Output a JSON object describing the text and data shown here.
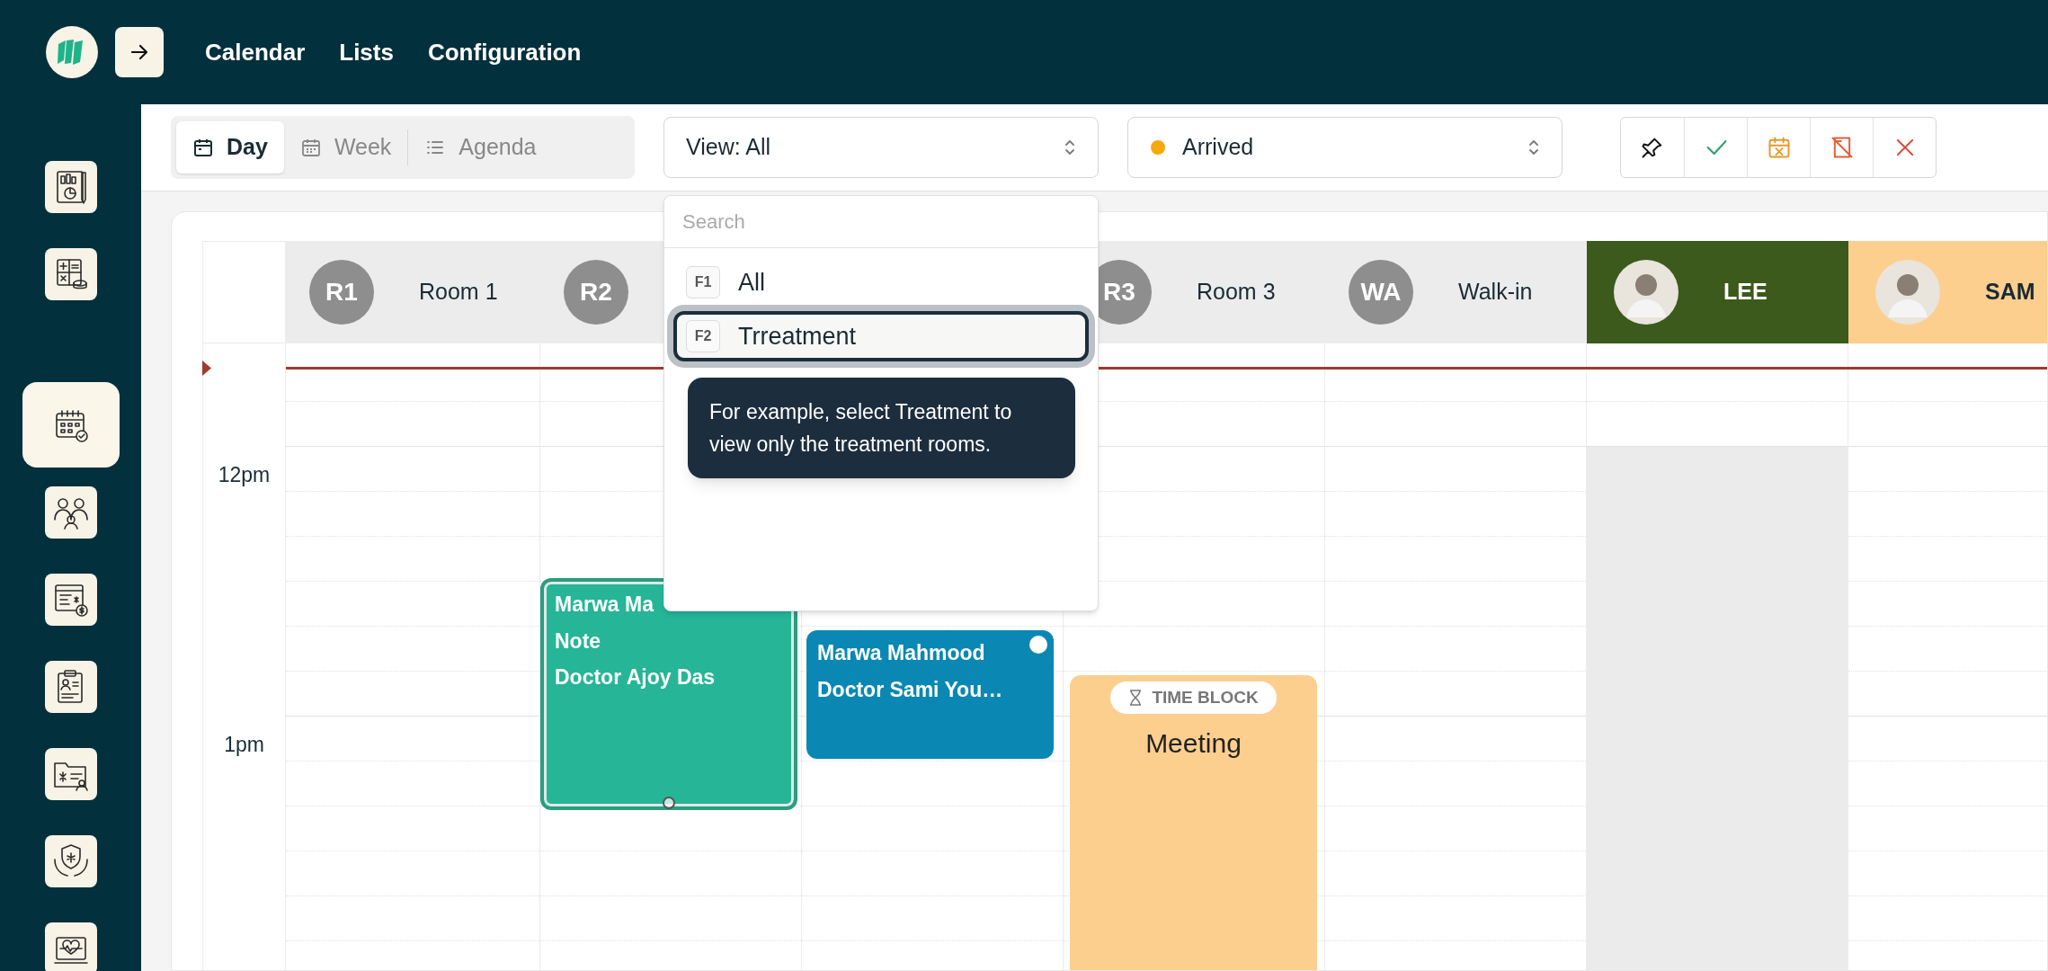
{
  "top_nav": [
    {
      "label": "Calendar"
    },
    {
      "label": "Lists"
    },
    {
      "label": "Configuration"
    }
  ],
  "sidebar_items": [
    {
      "selected": false
    },
    {
      "selected": false
    },
    {
      "selected": true
    },
    {
      "selected": false
    },
    {
      "selected": false
    },
    {
      "selected": false
    },
    {
      "selected": false
    },
    {
      "selected": false
    },
    {
      "selected": false
    }
  ],
  "view_tabs": [
    {
      "label": "Day",
      "selected": true
    },
    {
      "label": "Week",
      "selected": false
    },
    {
      "label": "Agenda",
      "selected": false
    }
  ],
  "view_select": {
    "value": "View: All"
  },
  "status_select": {
    "value": "Arrived"
  },
  "columns": [
    {
      "kind": "room",
      "badge": "R1",
      "label": "Room 1",
      "blocked": false
    },
    {
      "kind": "room",
      "badge": "R2",
      "blocked": false,
      "events": [
        {
          "kind": "appointment",
          "lines": [
            "Marwa Ma",
            "Note",
            "Doctor Ajoy Das"
          ],
          "color": "#26b597",
          "selected": true
        }
      ]
    },
    {
      "kind": "room",
      "blocked": false,
      "events": [
        {
          "kind": "appointment",
          "lines": [
            "Marwa Mahmood",
            "Doctor Sami You…"
          ],
          "color": "#0a88b3",
          "selected": false
        }
      ]
    },
    {
      "kind": "room",
      "badge": "R3",
      "label": "Room 3",
      "blocked": false,
      "events": [
        {
          "kind": "time_block",
          "tag": "TIME BLOCK",
          "title": "Meeting"
        }
      ]
    },
    {
      "kind": "room",
      "badge": "WA",
      "label": "Walk-in",
      "blocked": false
    },
    {
      "kind": "provider",
      "label": "LEE",
      "color": "#3b5a1c",
      "blocked": true
    },
    {
      "kind": "provider",
      "label": "SAM",
      "color": "#fdcf8f",
      "blocked": false
    }
  ],
  "time_labels": [
    "12pm",
    "1pm"
  ],
  "dropdown": {
    "search_placeholder": "Search",
    "options": [
      {
        "key": "F1",
        "label": "All",
        "selected": false
      },
      {
        "key": "F2",
        "label": "Trreatment",
        "selected": true
      }
    ]
  },
  "tooltip": {
    "text": "For example, select Treatment to view only the treatment rooms."
  }
}
